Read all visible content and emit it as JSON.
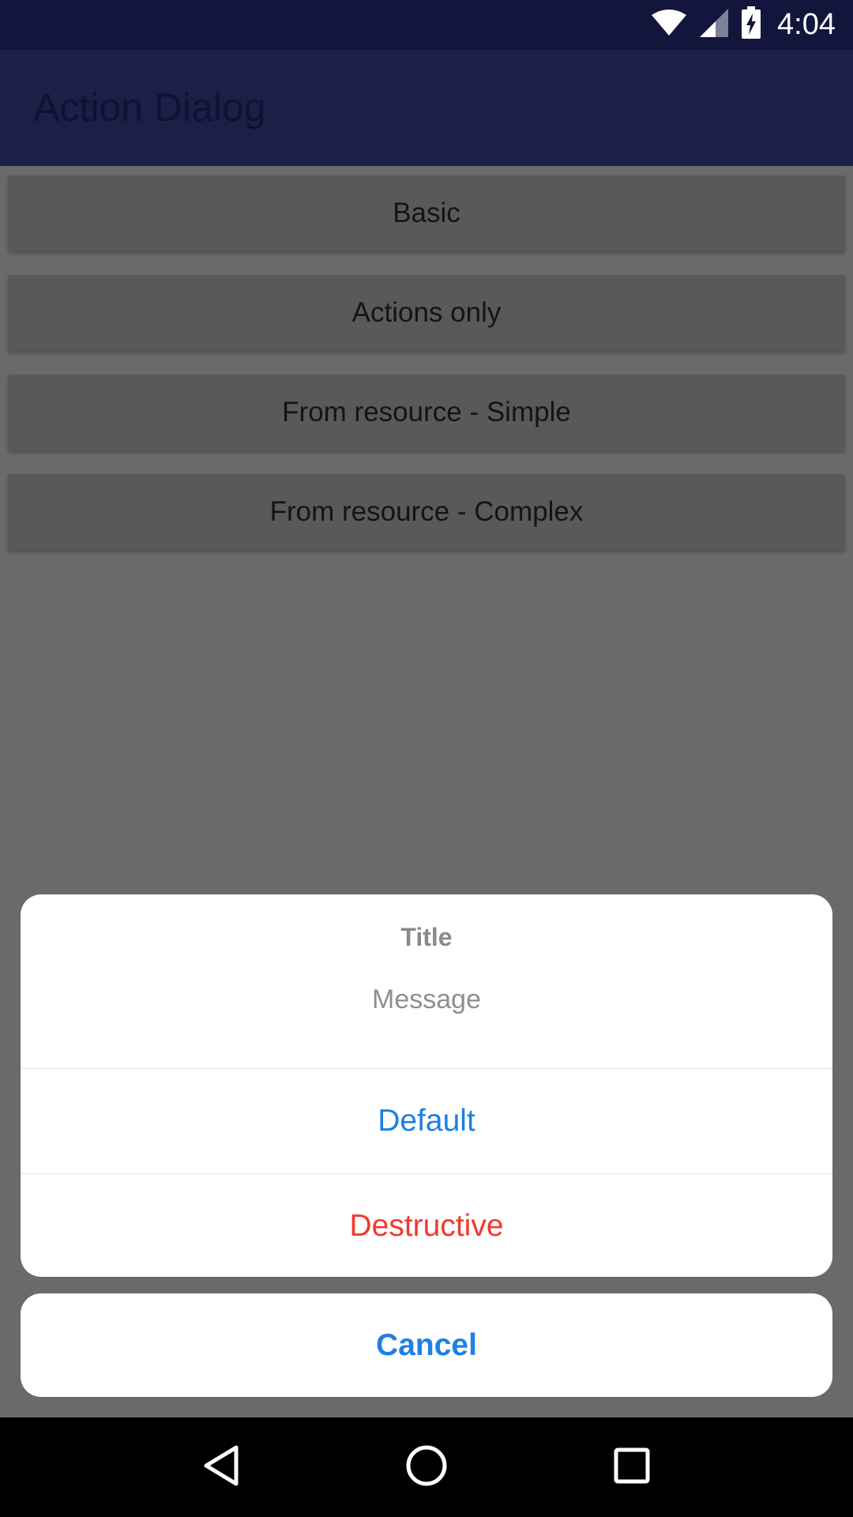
{
  "status_bar": {
    "time": "4:04",
    "icons": [
      "wifi-icon",
      "signal-icon",
      "battery-charging-icon"
    ]
  },
  "app_bar": {
    "title": "Action Dialog"
  },
  "buttons": [
    {
      "label": "Basic"
    },
    {
      "label": "Actions only"
    },
    {
      "label": "From resource - Simple"
    },
    {
      "label": "From resource - Complex"
    }
  ],
  "action_sheet": {
    "title": "Title",
    "message": "Message",
    "actions": [
      {
        "label": "Default",
        "style": "default"
      },
      {
        "label": "Destructive",
        "style": "destructive"
      }
    ],
    "cancel_label": "Cancel"
  },
  "nav_bar": {
    "icons": [
      "back-icon",
      "home-icon",
      "recents-icon"
    ]
  },
  "colors": {
    "status_bar_bg": "#12163d",
    "app_bar_bg": "#1a2048",
    "action_blue": "#1e7fe6",
    "destructive_red": "#f03a2e"
  }
}
